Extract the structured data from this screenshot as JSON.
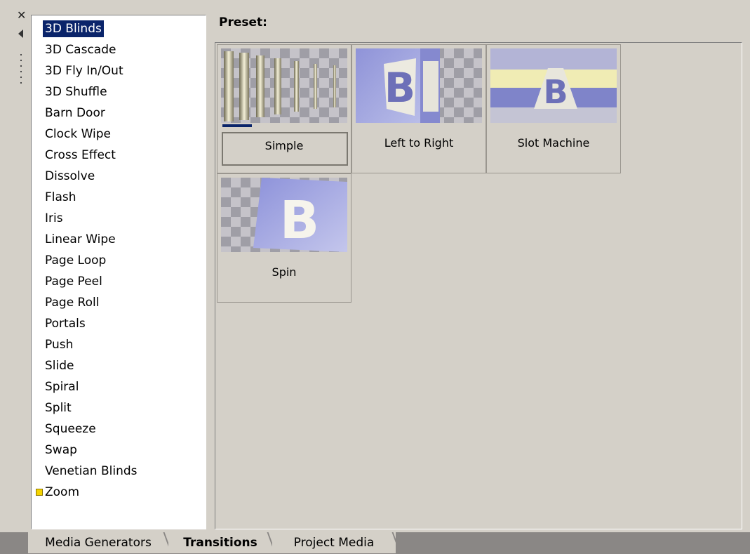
{
  "dock": {
    "close_icon": "close-icon",
    "pin_icon": "pin-icon",
    "grip_icon": "grip-icon"
  },
  "list": {
    "selected_index": 0,
    "items": [
      "3D Blinds",
      "3D Cascade",
      "3D Fly In/Out",
      "3D Shuffle",
      "Barn Door",
      "Clock Wipe",
      "Cross Effect",
      "Dissolve",
      "Flash",
      "Iris",
      "Linear Wipe",
      "Page Loop",
      "Page Peel",
      "Page Roll",
      "Portals",
      "Push",
      "Slide",
      "Spiral",
      "Split",
      "Squeeze",
      "Swap",
      "Venetian Blinds",
      "Zoom"
    ]
  },
  "preset": {
    "header": "Preset:",
    "tiles": [
      {
        "label": "Simple",
        "selected": true
      },
      {
        "label": "Left to Right",
        "selected": false
      },
      {
        "label": "Slot Machine",
        "selected": false
      },
      {
        "label": "Spin",
        "selected": false
      }
    ]
  },
  "tabs": {
    "media_generators": "Media Generators",
    "transitions": "Transitions",
    "project_media": "Project Media",
    "active": "Transitions"
  },
  "colors": {
    "selection": "#0a246a",
    "panel": "#d4d0c8",
    "tabbar": "#8a8785"
  }
}
